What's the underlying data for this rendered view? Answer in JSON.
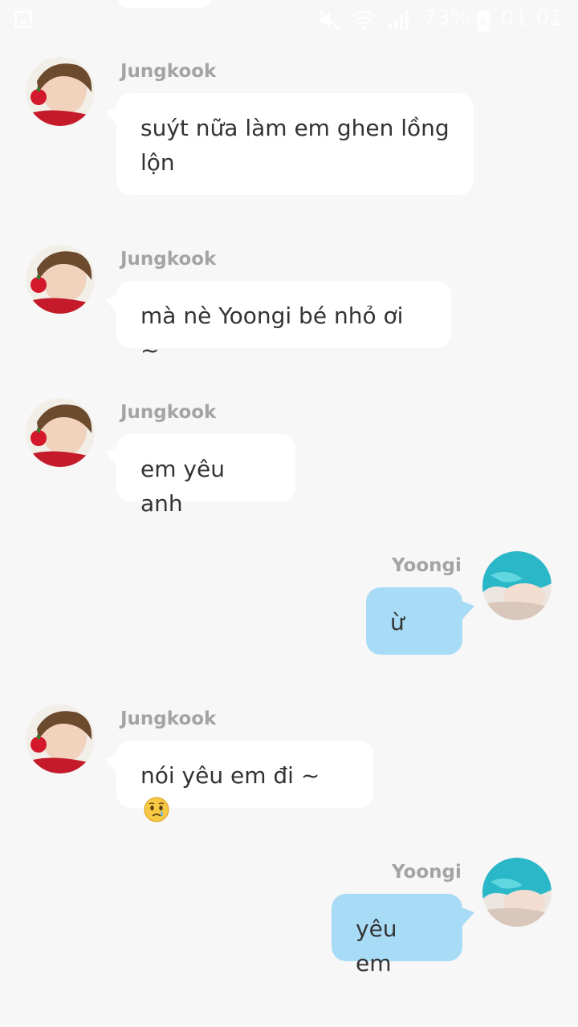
{
  "status_bar": {
    "battery": "73%",
    "time": "01:01"
  },
  "messages": [
    {
      "sender": "Jungkook",
      "text": "suýt nữa làm em ghen lồng lộn",
      "direction": "in"
    },
    {
      "sender": "Jungkook",
      "text": "mà nè Yoongi bé nhỏ ơi ~",
      "direction": "in"
    },
    {
      "sender": "Jungkook",
      "text": "em yêu anh",
      "direction": "in"
    },
    {
      "sender": "Yoongi",
      "text": "ừ",
      "direction": "out"
    },
    {
      "sender": "Jungkook",
      "text": "nói yêu em đi ~",
      "direction": "in",
      "emoji": "crying-face-emoji"
    },
    {
      "sender": "Yoongi",
      "text": "yêu em",
      "direction": "out"
    }
  ],
  "colors": {
    "background": "#f7f7f7",
    "incoming_bubble": "#ffffff",
    "outgoing_bubble": "#a8dcf6",
    "sender_name": "#a4a4a4",
    "message_text": "#333333"
  }
}
